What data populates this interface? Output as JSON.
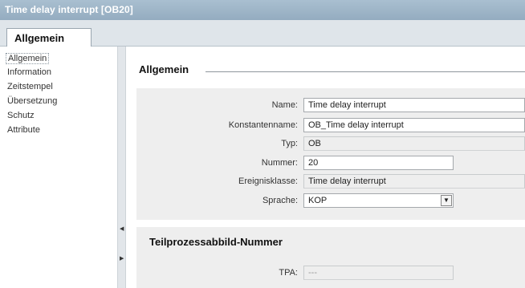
{
  "window": {
    "title": "Time delay interrupt [OB20]"
  },
  "tabs": [
    {
      "label": "Allgemein",
      "active": true
    }
  ],
  "sidebar": {
    "items": [
      {
        "label": "Allgemein",
        "active": true
      },
      {
        "label": "Information"
      },
      {
        "label": "Zeitstempel"
      },
      {
        "label": "Übersetzung"
      },
      {
        "label": "Schutz"
      },
      {
        "label": "Attribute"
      }
    ]
  },
  "splitter": {
    "collapse_icon": "triangle-left",
    "expand_icon": "triangle-right"
  },
  "section_general": {
    "title": "Allgemein",
    "fields": {
      "name": {
        "label": "Name:",
        "value": "Time delay interrupt"
      },
      "constant_name": {
        "label": "Konstantenname:",
        "value": "OB_Time delay interrupt"
      },
      "type": {
        "label": "Typ:",
        "value": "OB"
      },
      "number": {
        "label": "Nummer:",
        "value": "20"
      },
      "event_class": {
        "label": "Ereignisklasse:",
        "value": "Time delay interrupt"
      },
      "language": {
        "label": "Sprache:",
        "value": "KOP"
      }
    }
  },
  "section_process_image": {
    "title": "Teilprozessabbild-Nummer",
    "fields": {
      "tpa": {
        "label": "TPA:",
        "value": "---"
      }
    }
  },
  "colors": {
    "titlebar": "#a9bfd0",
    "panel": "#eeeeee",
    "tabstrip": "#dfe5ea"
  }
}
